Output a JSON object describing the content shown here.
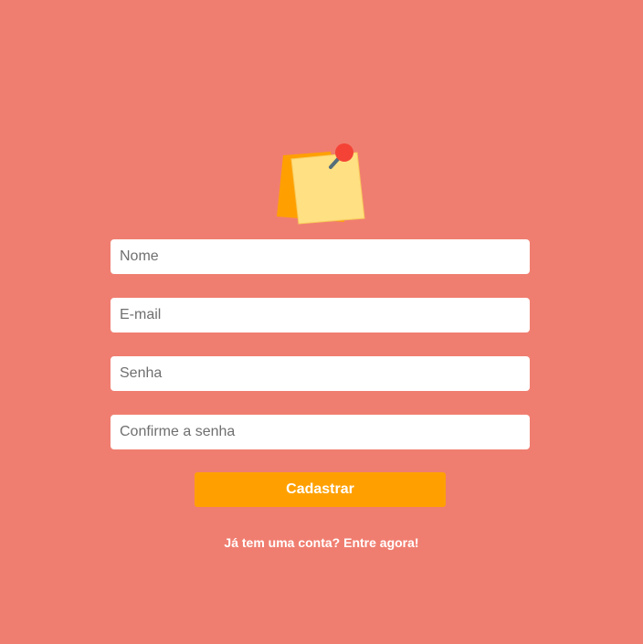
{
  "app": {
    "logo_icon": "sticky-note-with-pin-icon"
  },
  "form": {
    "name_placeholder": "Nome",
    "email_placeholder": "E-mail",
    "password_placeholder": "Senha",
    "confirm_password_placeholder": "Confirme a senha",
    "submit_label": "Cadastrar",
    "login_prompt": "Já tem uma conta? Entre agora!"
  },
  "colors": {
    "background": "#f07e70",
    "button": "#ffa000",
    "note_front": "#ffe082",
    "note_back": "#ffa000",
    "pin": "#f44336"
  }
}
